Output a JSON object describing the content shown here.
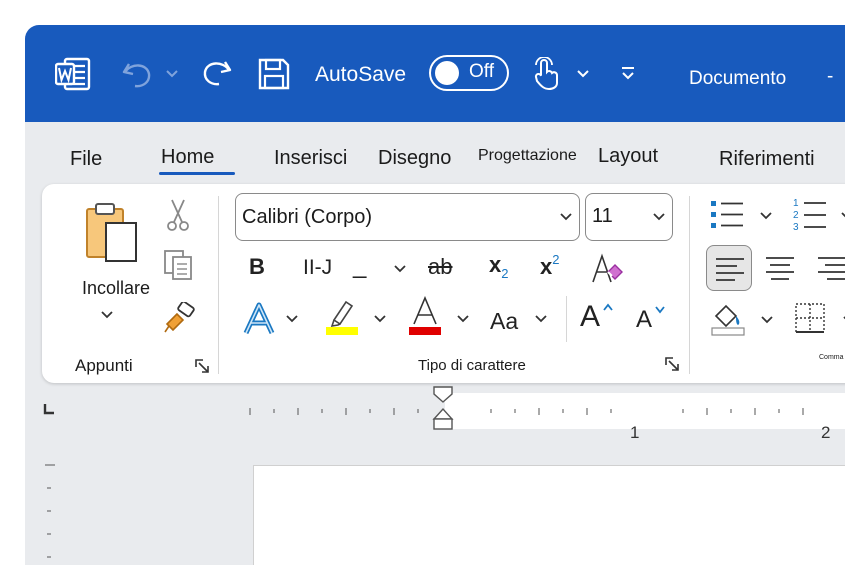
{
  "titlebar": {
    "autosave_label": "AutoSave",
    "autosave_state": "Off",
    "document_name": "Documento",
    "window_dash": "-"
  },
  "tabs": [
    {
      "label": "File",
      "active": false
    },
    {
      "label": "Home",
      "active": true
    },
    {
      "label": "Inserisci",
      "active": false
    },
    {
      "label": "Disegno",
      "active": false
    },
    {
      "label": "Progettazione",
      "active": false
    },
    {
      "label": "Layout",
      "active": false
    },
    {
      "label": "Riferimenti",
      "active": false
    }
  ],
  "clipboard": {
    "paste_label": "Incollare",
    "group_label": "Appunti"
  },
  "font": {
    "font_name": "Calibri (Corpo)",
    "font_size": "11",
    "bold": "B",
    "italic": "II-J",
    "underline": "_",
    "strike": "ab",
    "subscript": "x",
    "subscript_mark": "2",
    "superscript": "x",
    "superscript_mark": "2",
    "change_case": "Aa",
    "grow": "A",
    "shrink": "A",
    "group_label": "Tipo di carattere"
  },
  "paragraph": {
    "partial_label": "Comma"
  },
  "ruler": {
    "marks": [
      "1",
      "2"
    ]
  },
  "colors": {
    "titlebar": "#185abd",
    "highlight": "#ffff00",
    "font_color": "#e00000",
    "accent": "#185abd"
  }
}
